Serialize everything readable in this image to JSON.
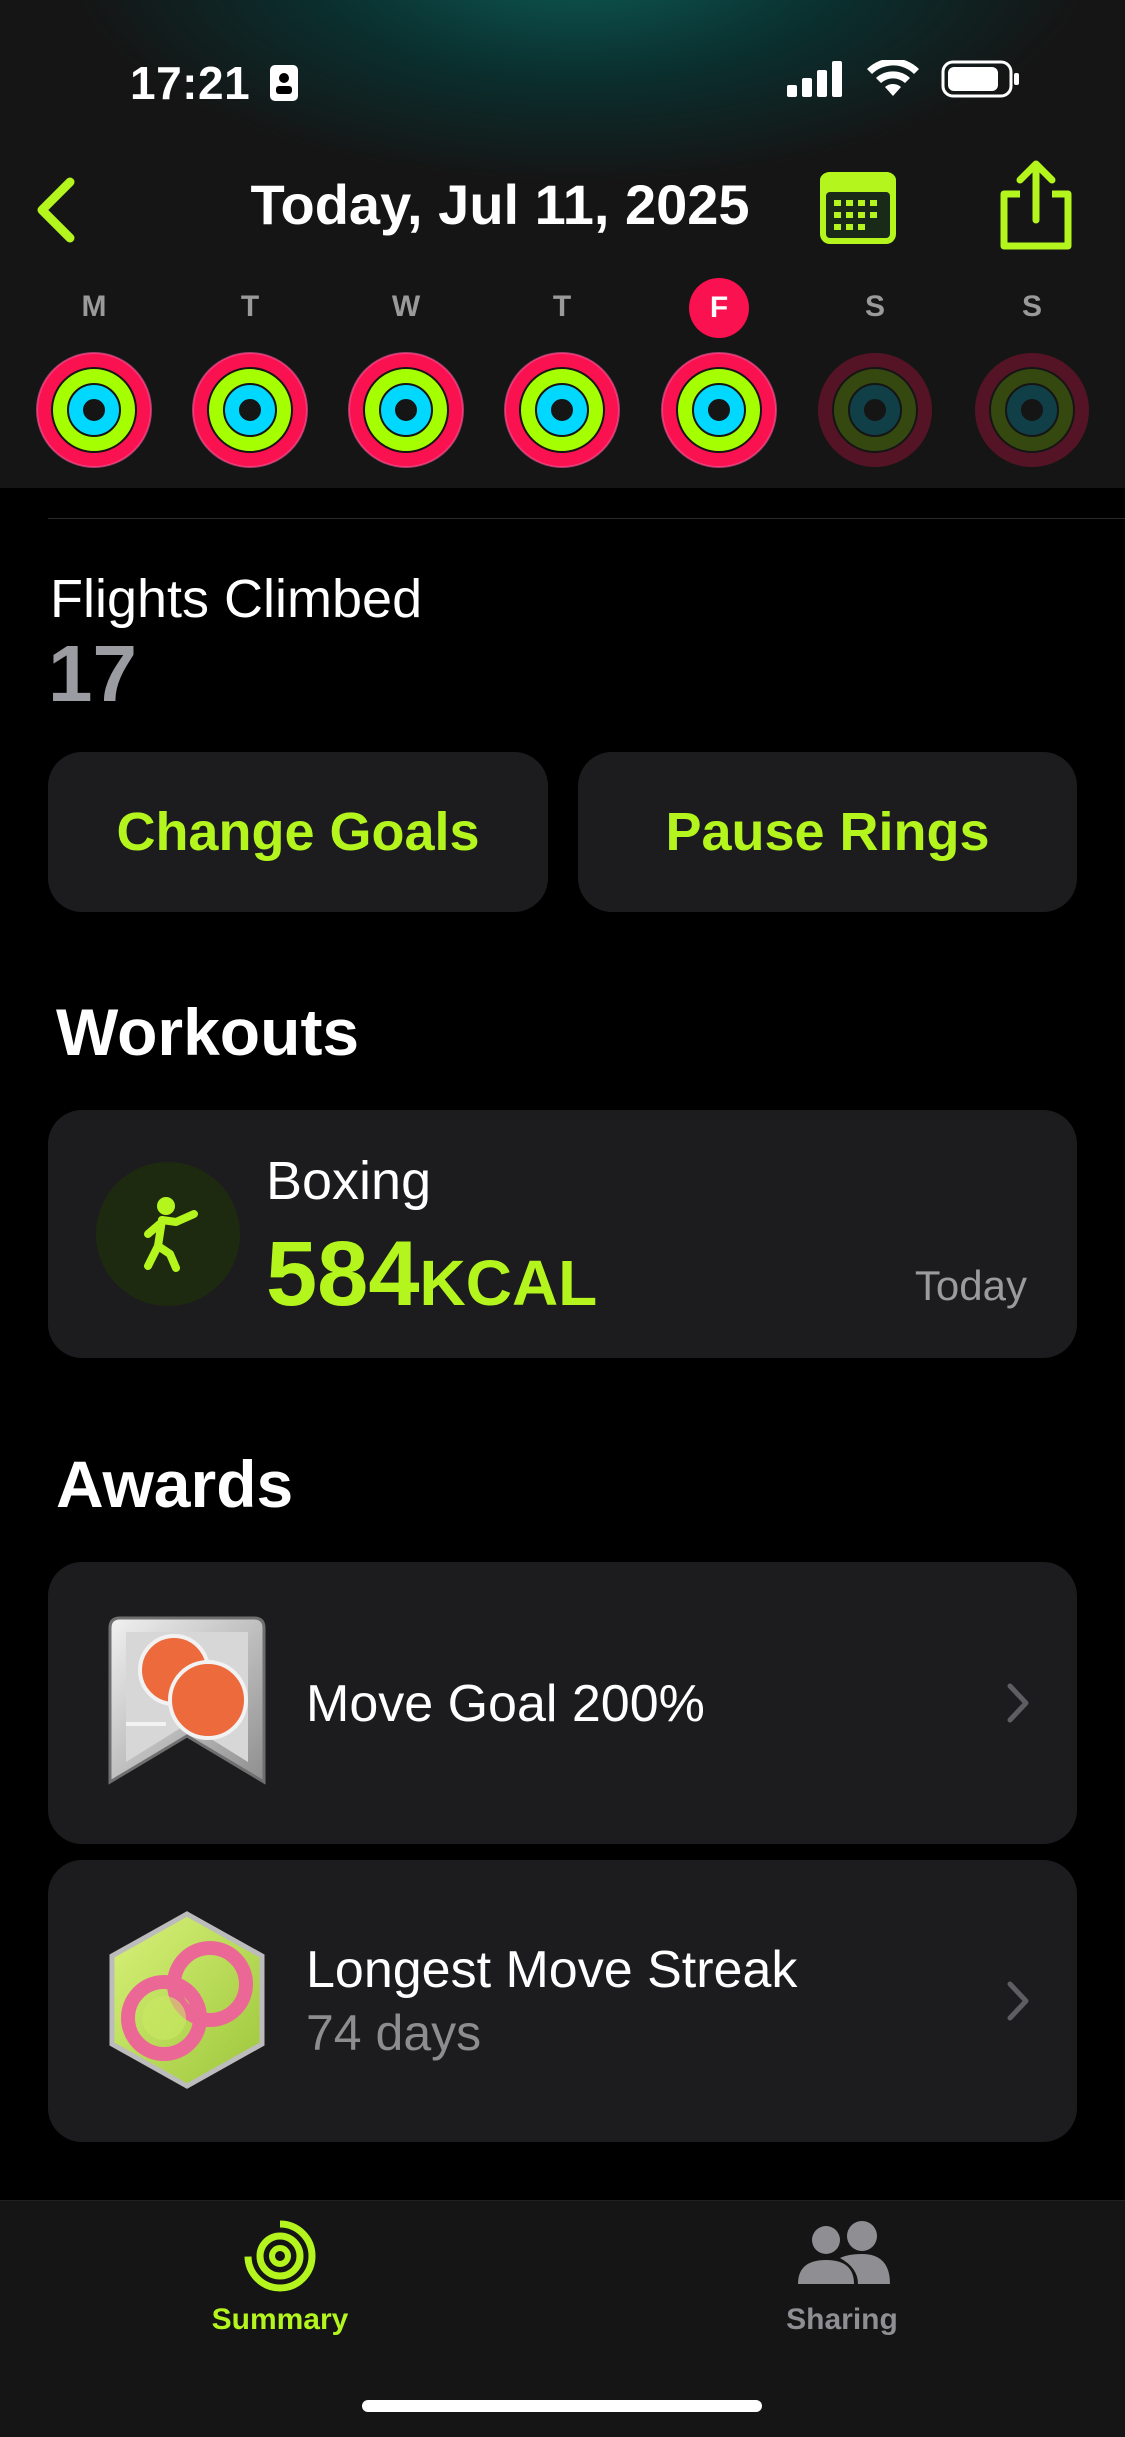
{
  "status_bar": {
    "time": "17:21"
  },
  "header": {
    "title": "Today, Jul 11, 2025"
  },
  "week": {
    "days": [
      {
        "letter": "M",
        "today": false
      },
      {
        "letter": "T",
        "today": false
      },
      {
        "letter": "W",
        "today": false
      },
      {
        "letter": "T",
        "today": false
      },
      {
        "letter": "F",
        "today": true
      },
      {
        "letter": "S",
        "today": false
      },
      {
        "letter": "S",
        "today": false
      }
    ]
  },
  "flights": {
    "label": "Flights Climbed",
    "value": "17"
  },
  "buttons": {
    "change_goals": "Change Goals",
    "pause_rings": "Pause Rings"
  },
  "workouts": {
    "heading": "Workouts",
    "items": [
      {
        "name": "Boxing",
        "kcal": "584",
        "unit": "KCAL",
        "date": "Today"
      }
    ]
  },
  "awards": {
    "heading": "Awards",
    "items": [
      {
        "title": "Move Goal 200%",
        "subtitle": ""
      },
      {
        "title": "Longest Move Streak",
        "subtitle": "74 days"
      }
    ]
  },
  "tabbar": {
    "summary": "Summary",
    "sharing": "Sharing"
  },
  "colors": {
    "accent": "#b4f51e",
    "move": "#fa114f",
    "exercise": "#a6ff00",
    "stand": "#00d8ff",
    "card": "#1c1c1e"
  }
}
